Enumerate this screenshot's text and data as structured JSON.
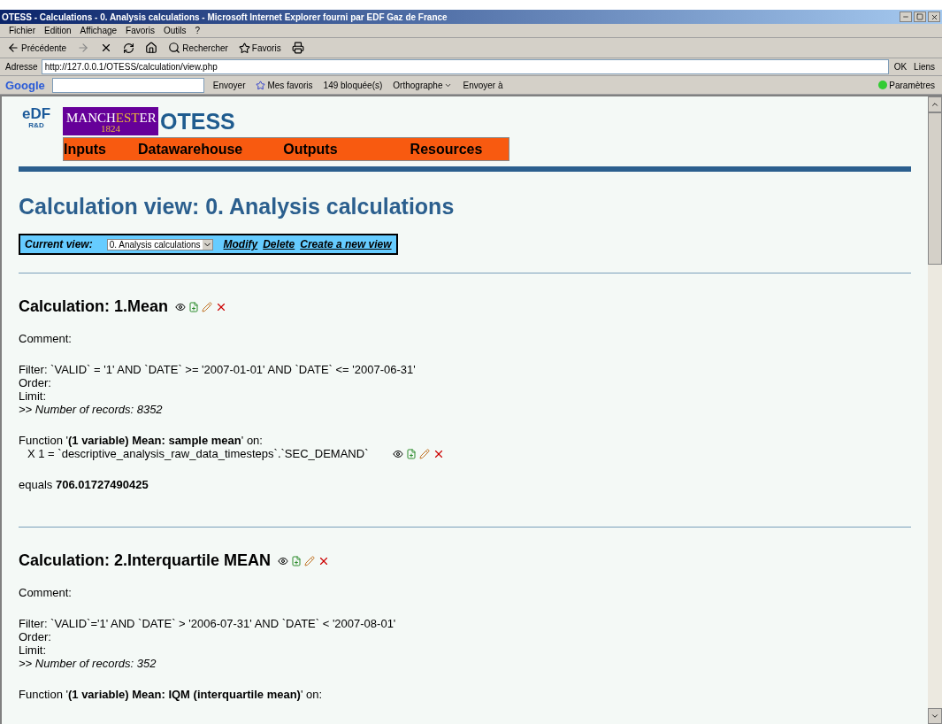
{
  "window": {
    "title": "OTESS - Calculations - 0. Analysis calculations - Microsoft Internet Explorer fourni par EDF Gaz de France"
  },
  "menu": [
    "Fichier",
    "Edition",
    "Affichage",
    "Favoris",
    "Outils",
    "?"
  ],
  "toolbar": {
    "back": "Précédente",
    "search": "Rechercher",
    "favorites": "Favoris"
  },
  "address": {
    "label": "Adresse",
    "value": "http://127.0.0.1/OTESS/calculation/view.php",
    "go": "OK",
    "links": "Liens"
  },
  "google_bar": {
    "brand": "Google",
    "send": "Envoyer",
    "favorites": "Mes favoris",
    "blocked": "149 bloquée(s)",
    "spelling": "Orthographe",
    "send_to": "Envoyer à",
    "settings": "Paramètres"
  },
  "logo": {
    "name": "eDF",
    "unit": "R&D"
  },
  "university": {
    "parts": [
      {
        "text": "MANCH",
        "highlight": false
      },
      {
        "text": "EST",
        "highlight": true
      },
      {
        "text": "ER",
        "highlight": false
      }
    ],
    "year": "1824"
  },
  "site_title": "OTESS",
  "nav": [
    "Inputs",
    "Datawarehouse",
    "Outputs",
    "Resources"
  ],
  "page_title": "Calculation view: 0. Analysis calculations",
  "view_bar": {
    "label": "Current view:",
    "value": "0. Analysis calculations",
    "links": [
      "Modify",
      "Delete",
      "Create a new view"
    ]
  },
  "calculations": [
    {
      "title": "Calculation: 1.Mean",
      "comment": "Comment:",
      "filter": "Filter: `VALID` = '1' AND `DATE` >= '2007-01-01' AND `DATE` <= '2007-06-31'",
      "order": "Order:",
      "limit": "Limit:",
      "records": ">> Number of records: 8352",
      "function": "Function '**(1 variable) Mean: sample mean**' on:",
      "variables": [
        "X 1 = `descriptive_analysis_raw_data_timesteps`.`SEC_DEMAND`"
      ],
      "result": "equals **706.01727490425**"
    },
    {
      "title": "Calculation: 2.Interquartile MEAN",
      "comment": "Comment:",
      "filter": "Filter: `VALID`='1' AND `DATE` > '2006-07-31' AND `DATE` < '2007-08-01'",
      "order": "Order:",
      "limit": "Limit:",
      "records": ">> Number of records: 352",
      "function": "Function '**(1 variable) Mean: IQM (interquartile mean)**' on:"
    }
  ]
}
